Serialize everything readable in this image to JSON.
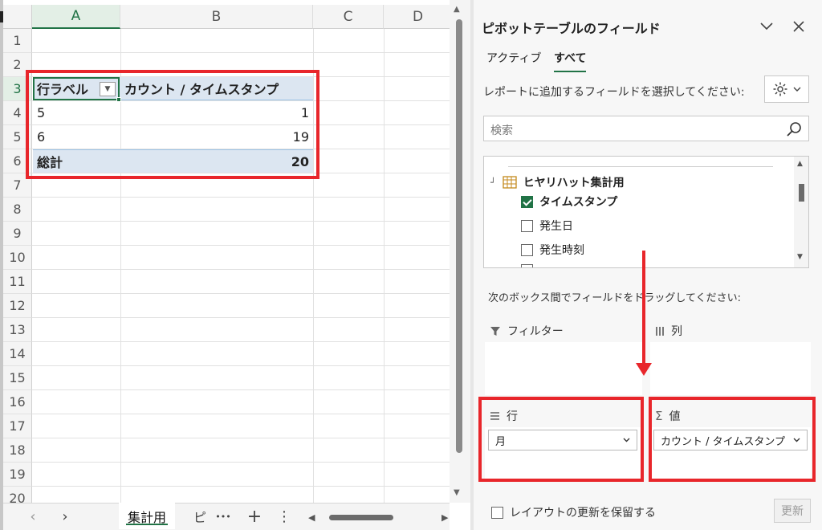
{
  "sheet": {
    "columns": [
      "A",
      "B",
      "C",
      "D"
    ],
    "selected_column": "A",
    "rows": [
      "1",
      "2",
      "3",
      "4",
      "5",
      "6",
      "7",
      "8",
      "9",
      "10",
      "11",
      "12",
      "13",
      "14",
      "15",
      "16",
      "17",
      "18",
      "19",
      "20"
    ],
    "selected_row": "3"
  },
  "pivot": {
    "header": {
      "row_label": "行ラベル",
      "value_label": "カウント / タイムスタンプ"
    },
    "rows": [
      {
        "label": "5",
        "value": "1"
      },
      {
        "label": "6",
        "value": "19"
      }
    ],
    "total": {
      "label": "総計",
      "value": "20"
    }
  },
  "sheet_tabs": {
    "prev": "‹",
    "next": "›",
    "active": "集計用",
    "partial": "ピ",
    "more": "•••",
    "add": "+",
    "options": "⋮"
  },
  "pane": {
    "title": "ピボットテーブルのフィールド",
    "tabs": [
      "アクティブ",
      "すべて"
    ],
    "active_tab": "すべて",
    "choose_hint": "レポートに追加するフィールドを選択してください:",
    "search_placeholder": "検索",
    "table_name": "ヒヤリハット集計用",
    "fields": [
      {
        "label": "タイムスタンプ",
        "checked": true
      },
      {
        "label": "発生日",
        "checked": false
      },
      {
        "label": "発生時刻",
        "checked": false
      }
    ],
    "drag_hint": "次のボックス間でフィールドをドラッグしてください:",
    "areas": {
      "filter": {
        "label": "フィルター"
      },
      "columns": {
        "label": "列"
      },
      "rows": {
        "label": "行",
        "item": "月"
      },
      "values": {
        "label": "値",
        "item": "カウント / タイムスタンプ"
      }
    },
    "defer_label": "レイアウトの更新を保留する",
    "update_button": "更新"
  },
  "colors": {
    "accent": "#217346",
    "highlight": "#e8262b",
    "pivot_fill": "#dce6f1"
  }
}
